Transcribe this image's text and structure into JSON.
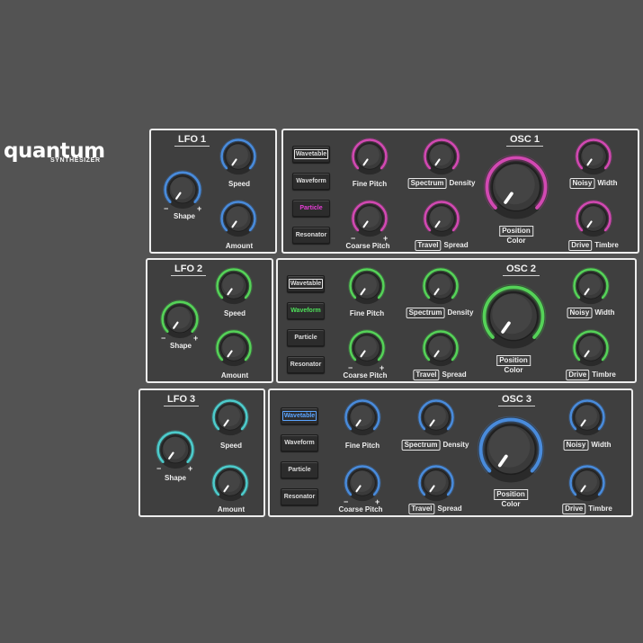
{
  "logo": {
    "main": "quantum",
    "sub": "SYNTHESIZER"
  },
  "colors": {
    "osc1": "#d94bb8",
    "osc2": "#57d95a",
    "osc3": "#4b8fe3",
    "lfo1": "#4b8fe3",
    "lfo2": "#57d95a",
    "lfo3": "#4fd2d2",
    "background": "#535353"
  },
  "minus": "−",
  "plus": "+",
  "lfo": [
    {
      "title": "LFO 1",
      "shape": "Shape",
      "speed": "Speed",
      "amount": "Amount"
    },
    {
      "title": "LFO 2",
      "shape": "Shape",
      "speed": "Speed",
      "amount": "Amount"
    },
    {
      "title": "LFO 3",
      "shape": "Shape",
      "speed": "Speed",
      "amount": "Amount"
    }
  ],
  "osc": [
    {
      "title": "OSC 1",
      "buttons": [
        "Wavetable",
        "Waveform",
        "Particle",
        "Resonator"
      ],
      "active_button": "Particle",
      "fine_pitch": "Fine Pitch",
      "coarse_pitch": "Coarse Pitch",
      "spectrum": "Spectrum",
      "density": "Density",
      "travel": "Travel",
      "spread": "Spread",
      "position": "Position",
      "color": "Color",
      "noisy": "Noisy",
      "width": "Width",
      "drive": "Drive",
      "timbre": "Timbre"
    },
    {
      "title": "OSC 2",
      "buttons": [
        "Wavetable",
        "Waveform",
        "Particle",
        "Resonator"
      ],
      "active_button": "Waveform",
      "fine_pitch": "Fine Pitch",
      "coarse_pitch": "Coarse Pitch",
      "spectrum": "Spectrum",
      "density": "Density",
      "travel": "Travel",
      "spread": "Spread",
      "position": "Position",
      "color": "Color",
      "noisy": "Noisy",
      "width": "Width",
      "drive": "Drive",
      "timbre": "Timbre"
    },
    {
      "title": "OSC 3",
      "buttons": [
        "Wavetable",
        "Waveform",
        "Particle",
        "Resonator"
      ],
      "active_button": "Wavetable",
      "fine_pitch": "Fine Pitch",
      "coarse_pitch": "Coarse Pitch",
      "spectrum": "Spectrum",
      "density": "Density",
      "travel": "Travel",
      "spread": "Spread",
      "position": "Position",
      "color": "Color",
      "noisy": "Noisy",
      "width": "Width",
      "drive": "Drive",
      "timbre": "Timbre"
    }
  ]
}
